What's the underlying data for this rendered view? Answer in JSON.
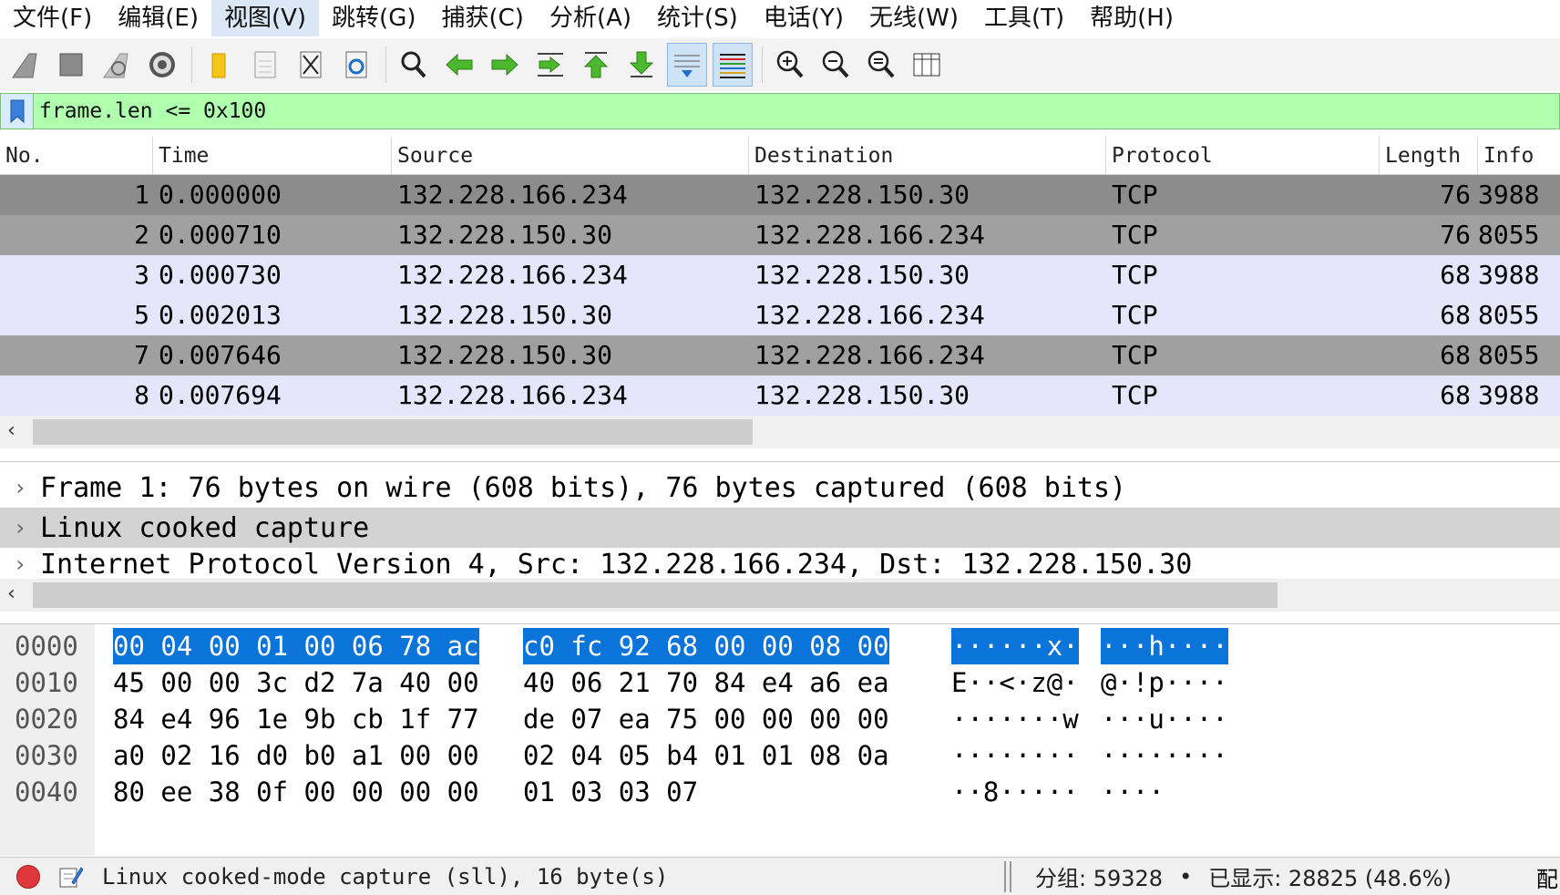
{
  "menu": [
    "文件(F)",
    "编辑(E)",
    "视图(V)",
    "跳转(G)",
    "捕获(C)",
    "分析(A)",
    "统计(S)",
    "电话(Y)",
    "无线(W)",
    "工具(T)",
    "帮助(H)"
  ],
  "toolbar": {
    "icons": [
      "shark-fin-start-icon",
      "stop-square-icon",
      "restart-shark-icon",
      "gear-options-icon",
      "folder-open-icon",
      "file-icon",
      "close-file-icon",
      "reload-icon",
      "search-magnifier-icon",
      "arrow-left-icon",
      "arrow-right-icon",
      "go-to-packet-icon",
      "go-first-icon",
      "go-last-icon",
      "autoscroll-icon",
      "colorize-icon",
      "zoom-in-icon",
      "zoom-out-icon",
      "zoom-normal-icon",
      "resize-columns-icon"
    ]
  },
  "filter": {
    "value": "frame.len <= 0x100"
  },
  "packet_list": {
    "columns": [
      "No.",
      "Time",
      "Source",
      "Destination",
      "Protocol",
      "Length",
      "Info"
    ],
    "rows": [
      {
        "no": "1",
        "time": "0.000000",
        "src": "132.228.166.234",
        "dst": "132.228.150.30",
        "proto": "TCP",
        "len": "76",
        "info": "3988"
      },
      {
        "no": "2",
        "time": "0.000710",
        "src": "132.228.150.30",
        "dst": "132.228.166.234",
        "proto": "TCP",
        "len": "76",
        "info": "8055"
      },
      {
        "no": "3",
        "time": "0.000730",
        "src": "132.228.166.234",
        "dst": "132.228.150.30",
        "proto": "TCP",
        "len": "68",
        "info": "3988"
      },
      {
        "no": "5",
        "time": "0.002013",
        "src": "132.228.150.30",
        "dst": "132.228.166.234",
        "proto": "TCP",
        "len": "68",
        "info": "8055"
      },
      {
        "no": "7",
        "time": "0.007646",
        "src": "132.228.150.30",
        "dst": "132.228.166.234",
        "proto": "TCP",
        "len": "68",
        "info": "8055"
      },
      {
        "no": "8",
        "time": "0.007694",
        "src": "132.228.166.234",
        "dst": "132.228.150.30",
        "proto": "TCP",
        "len": "68",
        "info": "3988"
      }
    ]
  },
  "details": [
    "Frame 1: 76 bytes on wire (608 bits), 76 bytes captured (608 bits)",
    "Linux cooked capture",
    "Internet Protocol Version 4, Src: 132.228.166.234, Dst: 132.228.150.30"
  ],
  "bytes": [
    {
      "offset": "0000",
      "hex1": "00 04 00 01 00 06 78 ac",
      "hex2": "c0 fc 92 68 00 00 08 00",
      "ascii1": "······x·",
      "ascii2": "···h····"
    },
    {
      "offset": "0010",
      "hex1": "45 00 00 3c d2 7a 40 00",
      "hex2": "40 06 21 70 84 e4 a6 ea",
      "ascii1": "E··<·z@·",
      "ascii2": "@·!p····"
    },
    {
      "offset": "0020",
      "hex1": "84 e4 96 1e 9b cb 1f 77",
      "hex2": "de 07 ea 75 00 00 00 00",
      "ascii1": "·······w",
      "ascii2": "···u····"
    },
    {
      "offset": "0030",
      "hex1": "a0 02 16 d0 b0 a1 00 00",
      "hex2": "02 04 05 b4 01 01 08 0a",
      "ascii1": "········",
      "ascii2": "········"
    },
    {
      "offset": "0040",
      "hex1": "80 ee 38 0f 00 00 00 00",
      "hex2": "01 03 03 07",
      "ascii1": "··8·····",
      "ascii2": "····"
    }
  ],
  "status": {
    "text": "Linux cooked-mode capture (sll), 16 byte(s)",
    "packets": "分组: 59328",
    "bullet": "•",
    "displayed": "已显示: 28825 (48.6%)",
    "profile": "配"
  },
  "colors": {
    "filter_ok": "#afffaf",
    "row_gray": "#a0a0a0",
    "row_lavender": "#e5e5fc",
    "highlight": "#0a74da"
  }
}
